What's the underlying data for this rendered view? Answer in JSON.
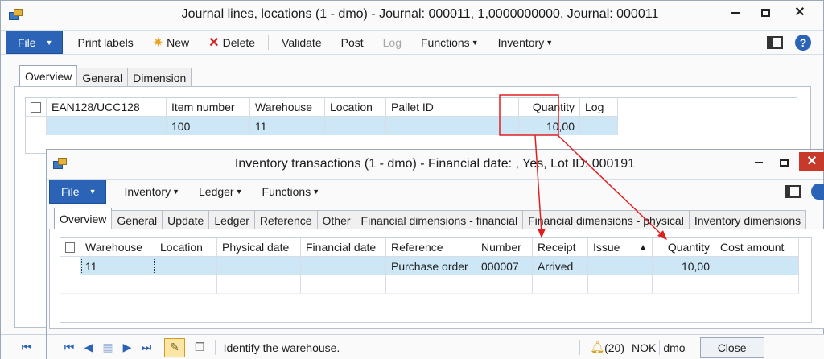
{
  "back": {
    "title": "Journal lines, locations (1 - dmo) - Journal: 000011, 1,0000000000, Journal: 000011",
    "actions": {
      "file": "File",
      "print_labels": "Print labels",
      "new": "New",
      "delete": "Delete",
      "validate": "Validate",
      "post": "Post",
      "log": "Log",
      "functions": "Functions",
      "inventory": "Inventory"
    },
    "tabs": [
      "Overview",
      "General",
      "Dimension"
    ],
    "grid": {
      "headers": [
        "EAN128/UCC128",
        "Item number",
        "Warehouse",
        "Location",
        "Pallet ID",
        "Quantity",
        "Log"
      ],
      "row": [
        "",
        "100",
        "11",
        "",
        "",
        "10,00",
        ""
      ]
    }
  },
  "front": {
    "title": "Inventory transactions (1 - dmo) - Financial date: , Yes, Lot ID: 000191",
    "actions": {
      "file": "File",
      "inventory": "Inventory",
      "ledger": "Ledger",
      "functions": "Functions"
    },
    "tabs": [
      "Overview",
      "General",
      "Update",
      "Ledger",
      "Reference",
      "Other",
      "Financial dimensions - financial",
      "Financial dimensions - physical",
      "Inventory dimensions"
    ],
    "grid": {
      "headers": [
        "Warehouse",
        "Location",
        "Physical date",
        "Financial date",
        "Reference",
        "Number",
        "Receipt",
        "Issue",
        "Quantity",
        "Cost amount"
      ],
      "row": [
        "11",
        "",
        "",
        "",
        "Purchase order",
        "000007",
        "Arrived",
        "",
        "10,00",
        ""
      ]
    },
    "status": {
      "text": "Identify the warehouse.",
      "count": "(20)",
      "currency": "NOK",
      "company": "dmo",
      "close": "Close"
    }
  },
  "colors": {
    "accent": "#2b64b6",
    "selection": "#cde7f7",
    "annotation": "#e02020"
  }
}
